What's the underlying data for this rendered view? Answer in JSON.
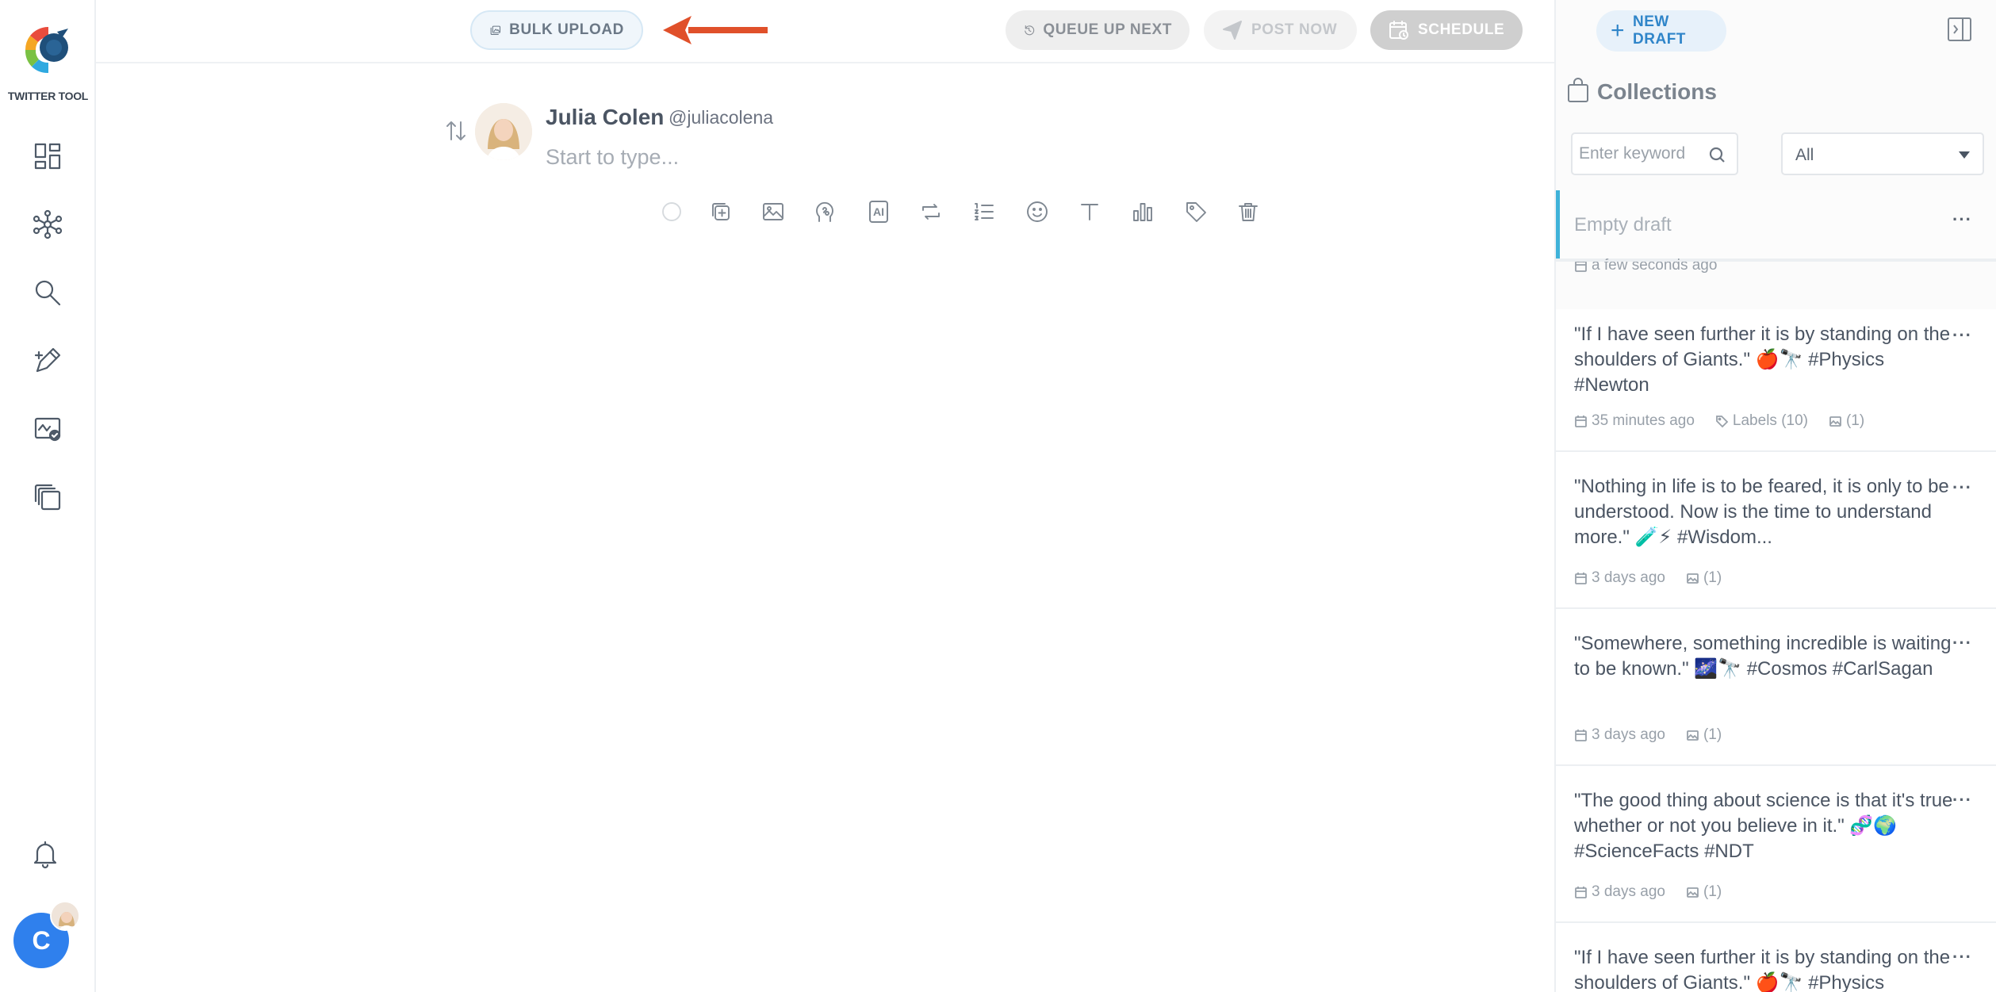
{
  "app": {
    "logo_text": "TWITTER TOOL",
    "account_initial": "C"
  },
  "toolbar": {
    "bulk_upload": "BULK UPLOAD",
    "queue_up_next": "QUEUE UP NEXT",
    "post_now": "POST NOW",
    "schedule": "SCHEDULE"
  },
  "composer": {
    "author_name": "Julia Colen",
    "author_handle": "@juliacolena",
    "placeholder": "Start to type...",
    "tools": [
      "circle-icon",
      "add-thread-icon",
      "image-icon",
      "brain-icon",
      "ai-icon",
      "retweet-icon",
      "list-icon",
      "emoji-icon",
      "text-format-icon",
      "chart-icon",
      "tag-icon",
      "trash-icon"
    ]
  },
  "panel": {
    "new_draft": "NEW DRAFT",
    "collections_title": "Collections",
    "search_placeholder": "Enter keyword",
    "filter_value": "All",
    "drafts": [
      {
        "text": "Empty draft",
        "time": "a few seconds ago",
        "labels": "",
        "media": ""
      },
      {
        "text": "\"If I have seen further it is by standing on the shoulders of Giants.\" 🍎🔭 #Physics #Newton",
        "time": "35 minutes ago",
        "labels": "Labels (10)",
        "media": "(1)"
      },
      {
        "text": "\"Nothing in life is to be feared, it is only to be understood. Now is the time to understand more.\" 🧪⚡ #Wisdom...",
        "time": "3 days ago",
        "labels": "",
        "media": "(1)"
      },
      {
        "text": "\"Somewhere, something incredible is waiting to be known.\" 🌌🔭 #Cosmos #CarlSagan",
        "time": "3 days ago",
        "labels": "",
        "media": "(1)"
      },
      {
        "text": "\"The good thing about science is that it's true whether or not you believe in it.\" 🧬🌍 #ScienceFacts #NDT",
        "time": "3 days ago",
        "labels": "",
        "media": "(1)"
      },
      {
        "text": "\"If I have seen further it is by standing on the shoulders of Giants.\" 🍎🔭 #Physics",
        "time": "",
        "labels": "",
        "media": ""
      }
    ]
  },
  "colors": {
    "accent": "#2f80ed",
    "active_bar": "#3fb2d9",
    "arrow": "#e0502a",
    "new_draft_text": "#2f85c9"
  }
}
